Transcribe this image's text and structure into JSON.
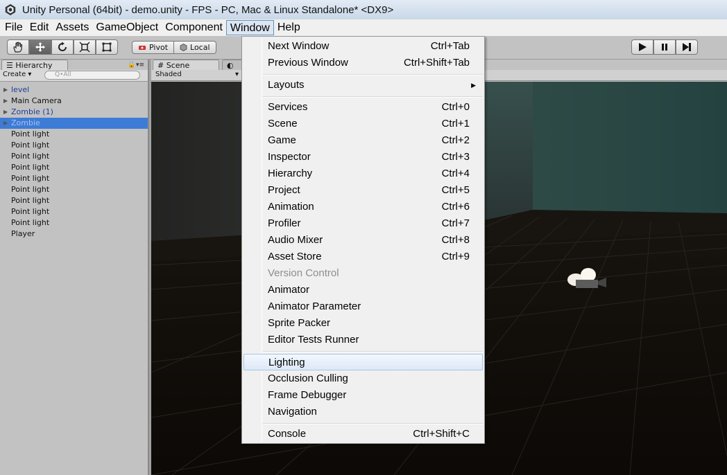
{
  "window": {
    "title": "Unity Personal (64bit) - demo.unity - FPS - PC, Mac & Linux Standalone* <DX9>"
  },
  "menubar": {
    "items": [
      "File",
      "Edit",
      "Assets",
      "GameObject",
      "Component",
      "Window",
      "Help"
    ]
  },
  "toolbar": {
    "pivot_label": "Pivot",
    "local_label": "Local"
  },
  "hierarchy": {
    "tab_label": "Hierarchy",
    "create_label": "Create",
    "search_placeholder": "Q•All",
    "items": [
      {
        "label": "level",
        "type": "prefab",
        "expandable": true
      },
      {
        "label": "Main Camera",
        "type": "normal",
        "expandable": true
      },
      {
        "label": "Zombie (1)",
        "type": "prefab",
        "expandable": true
      },
      {
        "label": "Zombie",
        "type": "selected",
        "expandable": true
      },
      {
        "label": "Point light",
        "type": "normal",
        "expandable": false
      },
      {
        "label": "Point light",
        "type": "normal",
        "expandable": false
      },
      {
        "label": "Point light",
        "type": "normal",
        "expandable": false
      },
      {
        "label": "Point light",
        "type": "normal",
        "expandable": false
      },
      {
        "label": "Point light",
        "type": "normal",
        "expandable": false
      },
      {
        "label": "Point light",
        "type": "normal",
        "expandable": false
      },
      {
        "label": "Point light",
        "type": "normal",
        "expandable": false
      },
      {
        "label": "Point light",
        "type": "normal",
        "expandable": false
      },
      {
        "label": "Point light",
        "type": "normal",
        "expandable": false
      },
      {
        "label": "Player",
        "type": "normal",
        "expandable": false
      }
    ]
  },
  "scene": {
    "tab_label": "Scene",
    "shading_label": "Shaded"
  },
  "window_menu": {
    "items": [
      {
        "label": "Next Window",
        "shortcut": "Ctrl+Tab"
      },
      {
        "label": "Previous Window",
        "shortcut": "Ctrl+Shift+Tab"
      },
      {
        "label": "Layouts",
        "shortcut": "",
        "submenu": true
      },
      {
        "label": "Services",
        "shortcut": "Ctrl+0"
      },
      {
        "label": "Scene",
        "shortcut": "Ctrl+1"
      },
      {
        "label": "Game",
        "shortcut": "Ctrl+2"
      },
      {
        "label": "Inspector",
        "shortcut": "Ctrl+3"
      },
      {
        "label": "Hierarchy",
        "shortcut": "Ctrl+4"
      },
      {
        "label": "Project",
        "shortcut": "Ctrl+5"
      },
      {
        "label": "Animation",
        "shortcut": "Ctrl+6"
      },
      {
        "label": "Profiler",
        "shortcut": "Ctrl+7"
      },
      {
        "label": "Audio Mixer",
        "shortcut": "Ctrl+8"
      },
      {
        "label": "Asset Store",
        "shortcut": "Ctrl+9"
      },
      {
        "label": "Version Control",
        "shortcut": "",
        "disabled": true
      },
      {
        "label": "Animator",
        "shortcut": ""
      },
      {
        "label": "Animator Parameter",
        "shortcut": ""
      },
      {
        "label": "Sprite Packer",
        "shortcut": ""
      },
      {
        "label": "Editor Tests Runner",
        "shortcut": ""
      },
      {
        "label": "Lighting",
        "shortcut": "",
        "hover": true
      },
      {
        "label": "Occlusion Culling",
        "shortcut": ""
      },
      {
        "label": "Frame Debugger",
        "shortcut": ""
      },
      {
        "label": "Navigation",
        "shortcut": ""
      },
      {
        "label": "Console",
        "shortcut": "Ctrl+Shift+C"
      }
    ]
  },
  "colors": {
    "selection": "#3d7cd6",
    "prefab_text": "#1f3c99",
    "menu_hover_border": "#a8c5ea"
  }
}
